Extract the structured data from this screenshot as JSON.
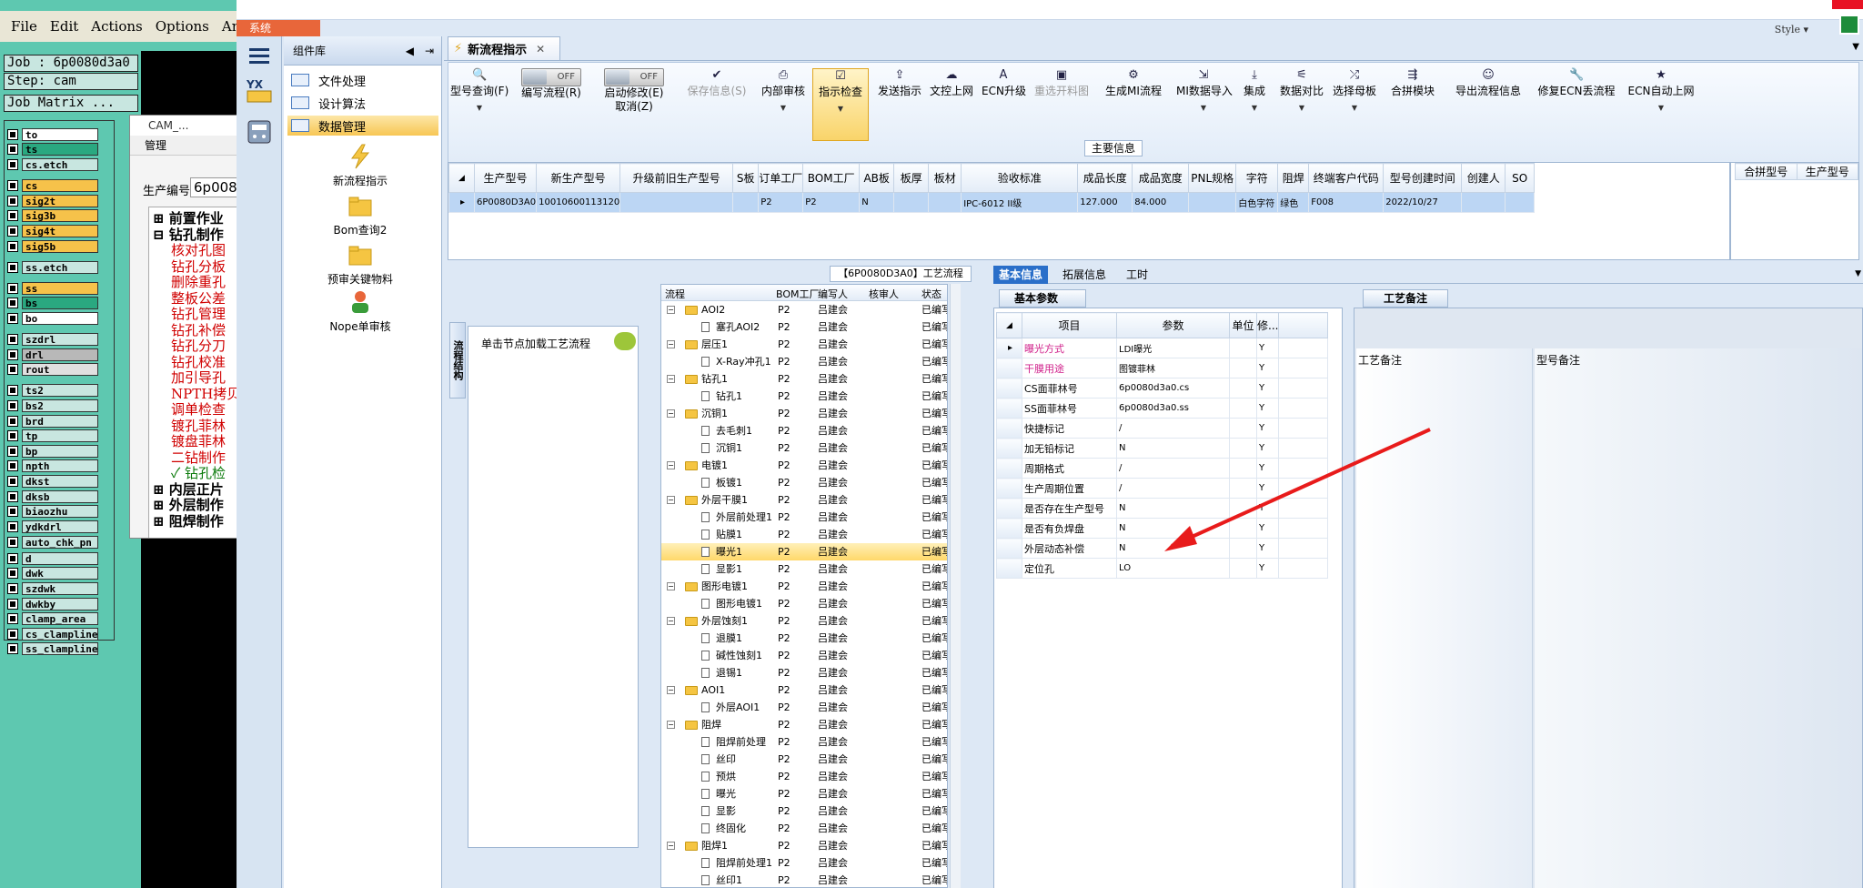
{
  "cam": {
    "menu": [
      "File",
      "Edit",
      "Actions",
      "Options",
      "Analy"
    ],
    "job": "Job : 6p0080d3a0",
    "step": "Step: cam",
    "matrix": "Job Matrix ...",
    "layers": [
      {
        "name": "to",
        "color": "#ffffff"
      },
      {
        "name": "ts",
        "color": "#2aa880"
      },
      {
        "name": "cs.etch",
        "color": "#c8e6e0"
      },
      {
        "name": "cs",
        "color": "#f6c24a"
      },
      {
        "name": "sig2t",
        "color": "#f6c24a"
      },
      {
        "name": "sig3b",
        "color": "#f6c24a"
      },
      {
        "name": "sig4t",
        "color": "#f6c24a"
      },
      {
        "name": "sig5b",
        "color": "#f6c24a"
      },
      {
        "name": "ss.etch",
        "color": "#c8e6e0"
      },
      {
        "name": "ss",
        "color": "#f6c24a"
      },
      {
        "name": "bs",
        "color": "#2aa880"
      },
      {
        "name": "bo",
        "color": "#ffffff"
      },
      {
        "name": "szdrl",
        "color": "#c8e6e0"
      },
      {
        "name": "drl",
        "color": "#b8b8b8"
      },
      {
        "name": "rout",
        "color": "#e0e0e0"
      },
      {
        "name": "ts2",
        "color": "#c8e6e0"
      },
      {
        "name": "bs2",
        "color": "#c8e6e0"
      },
      {
        "name": "brd",
        "color": "#c8e6e0"
      },
      {
        "name": "tp",
        "color": "#c8e6e0"
      },
      {
        "name": "bp",
        "color": "#c8e6e0"
      },
      {
        "name": "npth",
        "color": "#c8e6e0"
      },
      {
        "name": "dkst",
        "color": "#c8e6e0"
      },
      {
        "name": "dksb",
        "color": "#c8e6e0"
      },
      {
        "name": "biaozhu",
        "color": "#c8e6e0"
      },
      {
        "name": "ydkdrl",
        "color": "#c8e6e0"
      },
      {
        "name": "auto_chk_pn",
        "color": "#c8e6e0"
      },
      {
        "name": "d",
        "color": "#c8e6e0"
      },
      {
        "name": "dwk",
        "color": "#c8e6e0"
      },
      {
        "name": "szdwk",
        "color": "#c8e6e0"
      },
      {
        "name": "dwkby",
        "color": "#c8e6e0"
      },
      {
        "name": "clamp_area",
        "color": "#c8e6e0"
      },
      {
        "name": "cs_clampline",
        "color": "#c8e6e0"
      },
      {
        "name": "ss_clampline",
        "color": "#c8e6e0"
      }
    ],
    "popup": {
      "title": "CAM_...",
      "menu": "管理",
      "prod_label": "生产编号",
      "prod_value": "6p008",
      "tree": [
        {
          "text": "前置作业",
          "color": "#000",
          "level": 0,
          "sign": "+"
        },
        {
          "text": "钻孔制作",
          "color": "#000",
          "level": 0,
          "sign": "-"
        },
        {
          "text": "核对孔图",
          "color": "#d00000",
          "level": 1
        },
        {
          "text": "钻孔分板",
          "color": "#d00000",
          "level": 1
        },
        {
          "text": "删除重孔",
          "color": "#d00000",
          "level": 1
        },
        {
          "text": "整板公差",
          "color": "#d00000",
          "level": 1
        },
        {
          "text": "钻孔管理",
          "color": "#d00000",
          "level": 1
        },
        {
          "text": "钻孔补偿",
          "color": "#d00000",
          "level": 1
        },
        {
          "text": "钻孔分刀",
          "color": "#d00000",
          "level": 1
        },
        {
          "text": "钻孔校准",
          "color": "#d00000",
          "level": 1
        },
        {
          "text": "加引导孔",
          "color": "#d00000",
          "level": 1
        },
        {
          "text": "NPTH拷贝",
          "color": "#d00000",
          "level": 1
        },
        {
          "text": "调单检查",
          "color": "#d00000",
          "level": 1
        },
        {
          "text": "镀孔菲林",
          "color": "#d00000",
          "level": 1
        },
        {
          "text": "镀盘菲林",
          "color": "#d00000",
          "level": 1
        },
        {
          "text": "二钻制作",
          "color": "#d00000",
          "level": 1
        },
        {
          "text": "✓ 钻孔检",
          "color": "#0a7a0a",
          "level": 1
        },
        {
          "text": "内层正片",
          "color": "#000",
          "level": 0,
          "sign": "+"
        },
        {
          "text": "外层制作",
          "color": "#000",
          "level": 0,
          "sign": "+"
        },
        {
          "text": "阻焊制作",
          "color": "#000",
          "level": 0,
          "sign": "+"
        }
      ]
    }
  },
  "mes": {
    "system_tab": "系统",
    "style_label": "Style ▾",
    "components": {
      "title": "组件库",
      "items": [
        {
          "label": "文件处理",
          "active": false
        },
        {
          "label": "设计算法",
          "active": false
        },
        {
          "label": "数据管理",
          "active": true
        }
      ],
      "tools": [
        "新流程指示",
        "Bom查询2",
        "预审关键物料",
        "Nope单审核"
      ]
    },
    "doc_tab": "新流程指示",
    "toolbar": [
      {
        "label": "型号查询(F)",
        "icon": "search-icon",
        "glyph": "🔍",
        "dropdown": true,
        "disabled": false
      },
      {
        "label": "编写流程(R)",
        "icon": "toggle-off-icon",
        "toggle": "OFF",
        "dropdown": false,
        "disabled": false
      },
      {
        "label": "启动修改(E)",
        "label2": "取消(Z)",
        "icon": "toggle-off-icon",
        "toggle": "OFF",
        "dropdown": false,
        "disabled": false
      },
      {
        "label": "保存信息(S)",
        "icon": "save-icon",
        "glyph": "✔",
        "dropdown": false,
        "disabled": true
      },
      {
        "label": "内部审核",
        "icon": "print-icon",
        "glyph": "⎙",
        "dropdown": true,
        "disabled": false
      },
      {
        "label": "指示检查",
        "icon": "check-icon",
        "glyph": "☑",
        "dropdown": true,
        "disabled": false,
        "highlight": true
      },
      {
        "label": "发送指示",
        "icon": "upload-icon",
        "glyph": "⇪",
        "dropdown": false,
        "disabled": false
      },
      {
        "label": "文控上网",
        "icon": "cloud-icon",
        "glyph": "☁",
        "dropdown": false,
        "disabled": false
      },
      {
        "label": "ECN升级",
        "icon": "letter-a-icon",
        "glyph": "A",
        "dropdown": false,
        "disabled": false
      },
      {
        "label": "重选开料图",
        "icon": "image-icon",
        "glyph": "▣",
        "dropdown": false,
        "disabled": true
      },
      {
        "label": "生成MI流程",
        "icon": "gears-icon",
        "glyph": "⚙",
        "dropdown": false,
        "disabled": false
      },
      {
        "label": "MI数据导入",
        "icon": "import-icon",
        "glyph": "⇲",
        "dropdown": true,
        "disabled": false
      },
      {
        "label": "集成",
        "icon": "download-icon",
        "glyph": "⤓",
        "dropdown": true,
        "disabled": false
      },
      {
        "label": "数据对比",
        "icon": "compare-icon",
        "glyph": "⚟",
        "dropdown": true,
        "disabled": false
      },
      {
        "label": "选择母板",
        "icon": "shuffle-icon",
        "glyph": "⤮",
        "dropdown": true,
        "disabled": false
      },
      {
        "label": "合拼模块",
        "icon": "merge-icon",
        "glyph": "⇶",
        "dropdown": false,
        "disabled": false
      },
      {
        "label": "导出流程信息",
        "icon": "smiley-icon",
        "glyph": "☺",
        "dropdown": false,
        "disabled": false
      },
      {
        "label": "修复ECN丢流程",
        "icon": "wrench-icon",
        "glyph": "🔧",
        "dropdown": false,
        "disabled": false
      },
      {
        "label": "ECN自动上网",
        "icon": "star-icon",
        "glyph": "★",
        "dropdown": true,
        "disabled": false
      }
    ],
    "main_info": {
      "label": "主要信息",
      "columns": [
        "生产型号",
        "新生产型号",
        "升级前旧生产型号",
        "S板",
        "订单工厂",
        "BOM工厂",
        "AB板",
        "板厚",
        "板材",
        "验收标准",
        "成品长度",
        "成品宽度",
        "PNL规格",
        "字符",
        "阻焊",
        "终端客户代码",
        "型号创建时间",
        "创建人",
        "SO"
      ],
      "row": [
        "6P0080D3A0",
        "10010600113120",
        "",
        "",
        "P2",
        "P2",
        "N",
        "",
        "",
        "IPC-6012 II级",
        "127.000",
        "84.000",
        "",
        "白色字符",
        "绿色",
        "F008",
        "2022/10/27",
        "",
        ""
      ],
      "side_columns": [
        "合拼型号",
        "生产型号"
      ]
    },
    "flow": {
      "title": "【6P0080D3A0】工艺流程",
      "vtab": "流程结构",
      "hint": "单击节点加载工艺流程",
      "columns": [
        "流程",
        "BOM工厂",
        "编写人",
        "核审人",
        "状态"
      ],
      "rows": [
        {
          "name": "AOI2",
          "level": 0,
          "factory": "P2",
          "writer": "吕建会",
          "status": "已编写"
        },
        {
          "name": "塞孔AOI2",
          "level": 1,
          "factory": "P2",
          "writer": "吕建会",
          "status": "已编写"
        },
        {
          "name": "层压1",
          "level": 0,
          "factory": "P2",
          "writer": "吕建会",
          "status": "已编写"
        },
        {
          "name": "X-Ray冲孔1",
          "level": 1,
          "factory": "P2",
          "writer": "吕建会",
          "status": "已编写"
        },
        {
          "name": "钻孔1",
          "level": 0,
          "factory": "P2",
          "writer": "吕建会",
          "status": "已编写"
        },
        {
          "name": "钻孔1",
          "level": 1,
          "factory": "P2",
          "writer": "吕建会",
          "status": "已编写"
        },
        {
          "name": "沉铜1",
          "level": 0,
          "factory": "P2",
          "writer": "吕建会",
          "status": "已编写"
        },
        {
          "name": "去毛刺1",
          "level": 1,
          "factory": "P2",
          "writer": "吕建会",
          "status": "已编写"
        },
        {
          "name": "沉铜1",
          "level": 1,
          "factory": "P2",
          "writer": "吕建会",
          "status": "已编写"
        },
        {
          "name": "电镀1",
          "level": 0,
          "factory": "P2",
          "writer": "吕建会",
          "status": "已编写"
        },
        {
          "name": "板镀1",
          "level": 1,
          "factory": "P2",
          "writer": "吕建会",
          "status": "已编写"
        },
        {
          "name": "外层干膜1",
          "level": 0,
          "factory": "P2",
          "writer": "吕建会",
          "status": "已编写"
        },
        {
          "name": "外层前处理1",
          "level": 1,
          "factory": "P2",
          "writer": "吕建会",
          "status": "已编写"
        },
        {
          "name": "贴膜1",
          "level": 1,
          "factory": "P2",
          "writer": "吕建会",
          "status": "已编写"
        },
        {
          "name": "曝光1",
          "level": 1,
          "factory": "P2",
          "writer": "吕建会",
          "status": "已编写",
          "selected": true
        },
        {
          "name": "显影1",
          "level": 1,
          "factory": "P2",
          "writer": "吕建会",
          "status": "已编写"
        },
        {
          "name": "图形电镀1",
          "level": 0,
          "factory": "P2",
          "writer": "吕建会",
          "status": "已编写"
        },
        {
          "name": "图形电镀1",
          "level": 1,
          "factory": "P2",
          "writer": "吕建会",
          "status": "已编写"
        },
        {
          "name": "外层蚀刻1",
          "level": 0,
          "factory": "P2",
          "writer": "吕建会",
          "status": "已编写"
        },
        {
          "name": "退膜1",
          "level": 1,
          "factory": "P2",
          "writer": "吕建会",
          "status": "已编写"
        },
        {
          "name": "碱性蚀刻1",
          "level": 1,
          "factory": "P2",
          "writer": "吕建会",
          "status": "已编写"
        },
        {
          "name": "退锡1",
          "level": 1,
          "factory": "P2",
          "writer": "吕建会",
          "status": "已编写"
        },
        {
          "name": "AOI1",
          "level": 0,
          "factory": "P2",
          "writer": "吕建会",
          "status": "已编写"
        },
        {
          "name": "外层AOI1",
          "level": 1,
          "factory": "P2",
          "writer": "吕建会",
          "status": "已编写"
        },
        {
          "name": "阻焊",
          "level": 0,
          "factory": "P2",
          "writer": "吕建会",
          "status": "已编写"
        },
        {
          "name": "阻焊前处理",
          "level": 1,
          "factory": "P2",
          "writer": "吕建会",
          "status": "已编写"
        },
        {
          "name": "丝印",
          "level": 1,
          "factory": "P2",
          "writer": "吕建会",
          "status": "已编写"
        },
        {
          "name": "预烘",
          "level": 1,
          "factory": "P2",
          "writer": "吕建会",
          "status": "已编写"
        },
        {
          "name": "曝光",
          "level": 1,
          "factory": "P2",
          "writer": "吕建会",
          "status": "已编写"
        },
        {
          "name": "显影",
          "level": 1,
          "factory": "P2",
          "writer": "吕建会",
          "status": "已编写"
        },
        {
          "name": "终固化",
          "level": 1,
          "factory": "P2",
          "writer": "吕建会",
          "status": "已编写"
        },
        {
          "name": "阻焊1",
          "level": 0,
          "factory": "P2",
          "writer": "吕建会",
          "status": "已编写"
        },
        {
          "name": "阻焊前处理1",
          "level": 1,
          "factory": "P2",
          "writer": "吕建会",
          "status": "已编写"
        },
        {
          "name": "丝印1",
          "level": 1,
          "factory": "P2",
          "writer": "吕建会",
          "status": "已编写"
        }
      ]
    },
    "detail_tabs": [
      "基本信息",
      "拓展信息",
      "工时"
    ],
    "basic": {
      "title": "基本参数",
      "columns": [
        "项目",
        "参数",
        "单位",
        "修..."
      ],
      "rows": [
        {
          "item": "曝光方式",
          "value": "LDI曝光",
          "unit": "",
          "mod": "Y",
          "pink": true
        },
        {
          "item": "干膜用途",
          "value": "图镀菲林",
          "unit": "",
          "mod": "Y",
          "pink": true
        },
        {
          "item": "CS面菲林号",
          "value": "6p0080d3a0.cs",
          "unit": "",
          "mod": "Y"
        },
        {
          "item": "SS面菲林号",
          "value": "6p0080d3a0.ss",
          "unit": "",
          "mod": "Y"
        },
        {
          "item": "快捷标记",
          "value": "/",
          "unit": "",
          "mod": "Y"
        },
        {
          "item": "加无铅标记",
          "value": "N",
          "unit": "",
          "mod": "Y"
        },
        {
          "item": "周期格式",
          "value": "/",
          "unit": "",
          "mod": "Y"
        },
        {
          "item": "生产周期位置",
          "value": "/",
          "unit": "",
          "mod": "Y"
        },
        {
          "item": "是否存在生产型号",
          "value": "N",
          "unit": "",
          "mod": "Y"
        },
        {
          "item": "是否有负焊盘",
          "value": "N",
          "unit": "",
          "mod": "Y"
        },
        {
          "item": "外层动态补偿",
          "value": "N",
          "unit": "",
          "mod": "Y"
        },
        {
          "item": "定位孔",
          "value": "LO",
          "unit": "",
          "mod": "Y"
        }
      ]
    },
    "notes": {
      "title": "工艺备注",
      "col1": "工艺备注",
      "col2": "型号备注"
    }
  },
  "colors": {
    "accent_blue": "#2a6fc9",
    "selection_yellow": "#ffd86a",
    "arrow_red": "#e81b1b",
    "system_tab": "#e8663a"
  }
}
